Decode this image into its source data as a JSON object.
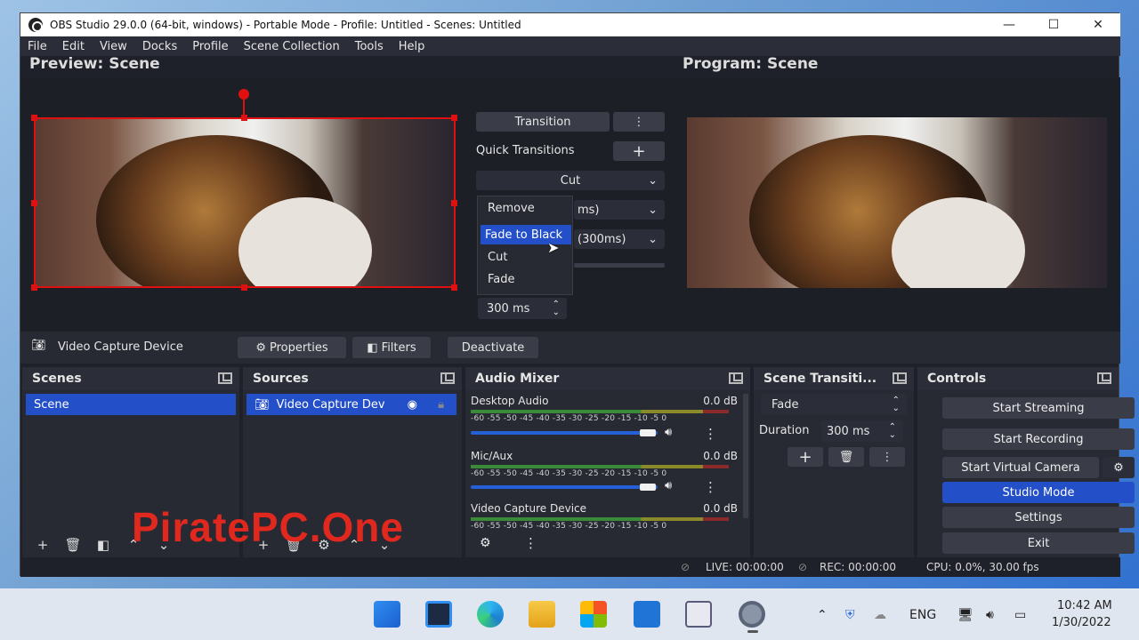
{
  "window": {
    "title": "OBS Studio 29.0.0 (64-bit, windows) - Portable Mode - Profile: Untitled - Scenes: Untitled",
    "controls": [
      "—",
      "☐",
      "✕"
    ]
  },
  "menu": [
    "File",
    "Edit",
    "View",
    "Docks",
    "Profile",
    "Scene Collection",
    "Tools",
    "Help"
  ],
  "preview": {
    "title": "Preview: Scene"
  },
  "program": {
    "title": "Program: Scene"
  },
  "transition_panel": {
    "transition_label": "Transition",
    "quick_transitions_label": "Quick Transitions",
    "cut_combo": "Cut",
    "combo2_partial": "ms)",
    "combo3_partial": "(300ms)",
    "duration_value": "300 ms"
  },
  "dropdown": {
    "items": [
      "Remove",
      "Fade to Black",
      "Cut",
      "Fade"
    ],
    "selected": "Fade to Black"
  },
  "source_toolbar": {
    "source_name": "Video Capture Device",
    "properties": "Properties",
    "filters": "Filters",
    "deactivate": "Deactivate"
  },
  "scenes": {
    "title": "Scenes",
    "items": [
      "Scene"
    ]
  },
  "sources": {
    "title": "Sources",
    "items": [
      "Video Capture Dev"
    ]
  },
  "audio_mixer": {
    "title": "Audio Mixer",
    "scale": "-60 -55 -50 -45 -40 -35 -30 -25 -20 -15 -10 -5 0",
    "channels": [
      {
        "name": "Desktop Audio",
        "db": "0.0 dB",
        "volume_fraction": 0.97
      },
      {
        "name": "Mic/Aux",
        "db": "0.0 dB",
        "volume_fraction": 0.97
      },
      {
        "name": "Video Capture Device",
        "db": "0.0 dB",
        "volume_fraction": 0.97
      }
    ]
  },
  "scene_transitions": {
    "title": "Scene Transiti...",
    "selected": "Fade",
    "duration_label": "Duration",
    "duration_value": "300 ms"
  },
  "controls": {
    "title": "Controls",
    "start_streaming": "Start Streaming",
    "start_recording": "Start Recording",
    "start_virtual_camera": "Start Virtual Camera",
    "studio_mode": "Studio Mode",
    "settings": "Settings",
    "exit": "Exit"
  },
  "status": {
    "live": "LIVE: 00:00:00",
    "rec": "REC: 00:00:00",
    "cpu": "CPU: 0.0%, 30.00 fps"
  },
  "watermark": "PiratePC.One",
  "taskbar": {
    "language": "ENG",
    "time": "10:42 AM",
    "date": "1/30/2022"
  },
  "colors": {
    "accent": "#2350c8",
    "selection": "#e01010",
    "panel": "#272a33"
  }
}
